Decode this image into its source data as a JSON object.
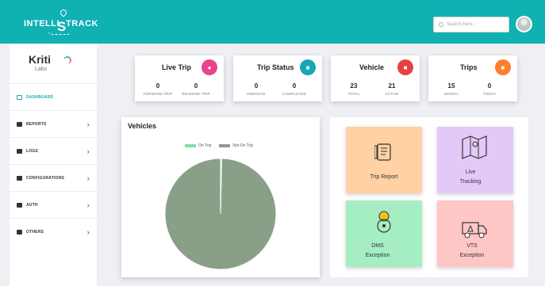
{
  "header": {
    "logo_text_left": "INTELLI",
    "logo_text_mid": "S",
    "logo_text_right": "TRACK",
    "search_placeholder": "Search here..."
  },
  "sidebar": {
    "brand_main": "Kriti",
    "brand_sub": "Labs",
    "items": [
      {
        "label": "DASHBOARD",
        "active": true
      },
      {
        "label": "REPORTS"
      },
      {
        "label": "LOGS"
      },
      {
        "label": "CONFIGURATIONS"
      },
      {
        "label": "AUTH"
      },
      {
        "label": "OTHERS"
      }
    ]
  },
  "stats": [
    {
      "title": "Live Trip",
      "icon": "pin-icon",
      "color": "#e8448c",
      "values": [
        {
          "value": "0",
          "label": "FORWARD TRIP"
        },
        {
          "value": "0",
          "label": "REVERSE TRIP"
        }
      ]
    },
    {
      "title": "Trip Status",
      "icon": "truck-icon",
      "color": "#17a6b8",
      "values": [
        {
          "value": "0",
          "label": "ENROUTE"
        },
        {
          "value": "0",
          "label": "COMPLETED"
        }
      ]
    },
    {
      "title": "Vehicle",
      "icon": "truck-icon",
      "color": "#e84040",
      "values": [
        {
          "value": "23",
          "label": "TOTAL"
        },
        {
          "value": "21",
          "label": "ACTIVE"
        }
      ]
    },
    {
      "title": "Trips",
      "icon": "bus-icon",
      "color": "#ff7d2e",
      "values": [
        {
          "value": "15",
          "label": "MONTH"
        },
        {
          "value": "0",
          "label": "TODAY"
        }
      ]
    }
  ],
  "vehicles": {
    "title": "Vehicles",
    "legend": [
      {
        "label": "On Trip",
        "color": "#7ee0a6"
      },
      {
        "label": "Not On Trip",
        "color": "#8a9f87"
      }
    ],
    "on_trip_fraction": 0.003
  },
  "tiles": [
    {
      "label_lines": [
        "Trip Report"
      ],
      "icon": "report-icon",
      "bg": "#ffd1a3"
    },
    {
      "label_lines": [
        "Live",
        "Tracking"
      ],
      "icon": "map-icon",
      "bg": "#e3c9f7"
    },
    {
      "label_lines": [
        "DMS",
        "Exception"
      ],
      "icon": "driver-icon",
      "bg": "#a5eec4"
    },
    {
      "label_lines": [
        "VTS",
        "Exception"
      ],
      "icon": "truck-alert-icon",
      "bg": "#ffc6c6"
    }
  ]
}
